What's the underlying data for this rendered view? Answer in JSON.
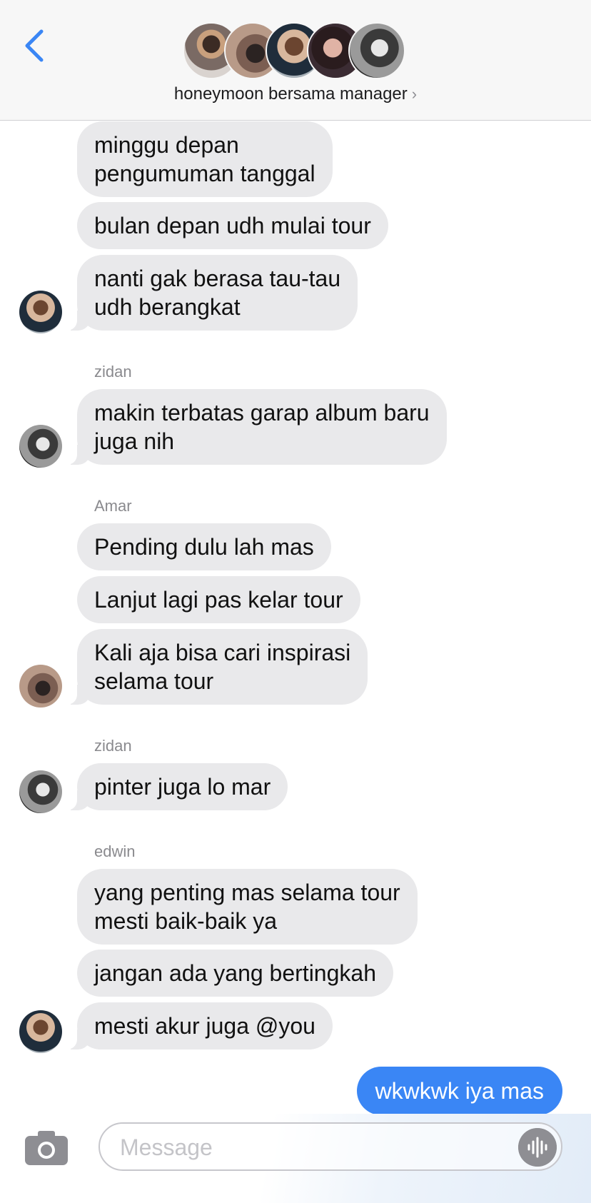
{
  "header": {
    "title": "honeymoon bersama manager",
    "chevron": "›",
    "back_icon": "chevron-left-icon"
  },
  "messages": [
    {
      "text_lines": [
        "minggu depan",
        "pengumuman tanggal"
      ]
    },
    {
      "text_lines": [
        "bulan depan udh mulai tour"
      ]
    },
    {
      "text_lines": [
        "nanti gak berasa tau-tau",
        "udh berangkat"
      ]
    },
    {
      "sender": "zidan"
    },
    {
      "text_lines": [
        "makin terbatas garap album baru",
        "juga nih"
      ]
    },
    {
      "sender": "Amar"
    },
    {
      "text_lines": [
        "Pending dulu lah mas"
      ]
    },
    {
      "text_lines": [
        "Lanjut lagi pas kelar tour"
      ]
    },
    {
      "text_lines": [
        "Kali aja bisa cari inspirasi",
        "selama tour"
      ]
    },
    {
      "sender": "zidan"
    },
    {
      "text_lines": [
        "pinter juga lo mar"
      ]
    },
    {
      "sender": "edwin"
    },
    {
      "text_lines": [
        "yang penting mas selama tour",
        "mesti baik-baik ya"
      ]
    },
    {
      "text_lines": [
        "jangan ada yang bertingkah"
      ]
    },
    {
      "text_lines": [
        "mesti akur juga @you"
      ]
    }
  ],
  "outgoing": {
    "text": "wkwkwk iya mas"
  },
  "composer": {
    "placeholder": "Message",
    "camera_icon": "camera-icon",
    "voice_icon": "waveform-icon"
  },
  "colors": {
    "accent": "#3a86f5",
    "incoming_bubble": "#e9e9eb",
    "header_bg": "#f7f7f7"
  }
}
